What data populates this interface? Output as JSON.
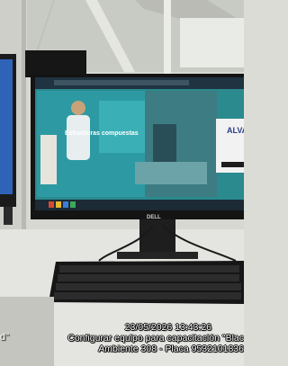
{
  "photo": {
    "monitor_brand": "DELL",
    "left_fragment": "d\"",
    "watermark": {
      "datetime": "23/05/2026 13:43:26",
      "description": "Configurar equipo para capacitación \"Blac",
      "location": "Ambiente 308 - Placa 9532101836"
    },
    "screen_text": {
      "banner_heading": "Estructuras compuestas",
      "logo_text": "ALVA"
    }
  },
  "colors": {
    "wall": "#d9d9d3",
    "monitor_bezel": "#161616",
    "screen_teal": "#2a8a8e",
    "caption_text": "#ffffff"
  }
}
